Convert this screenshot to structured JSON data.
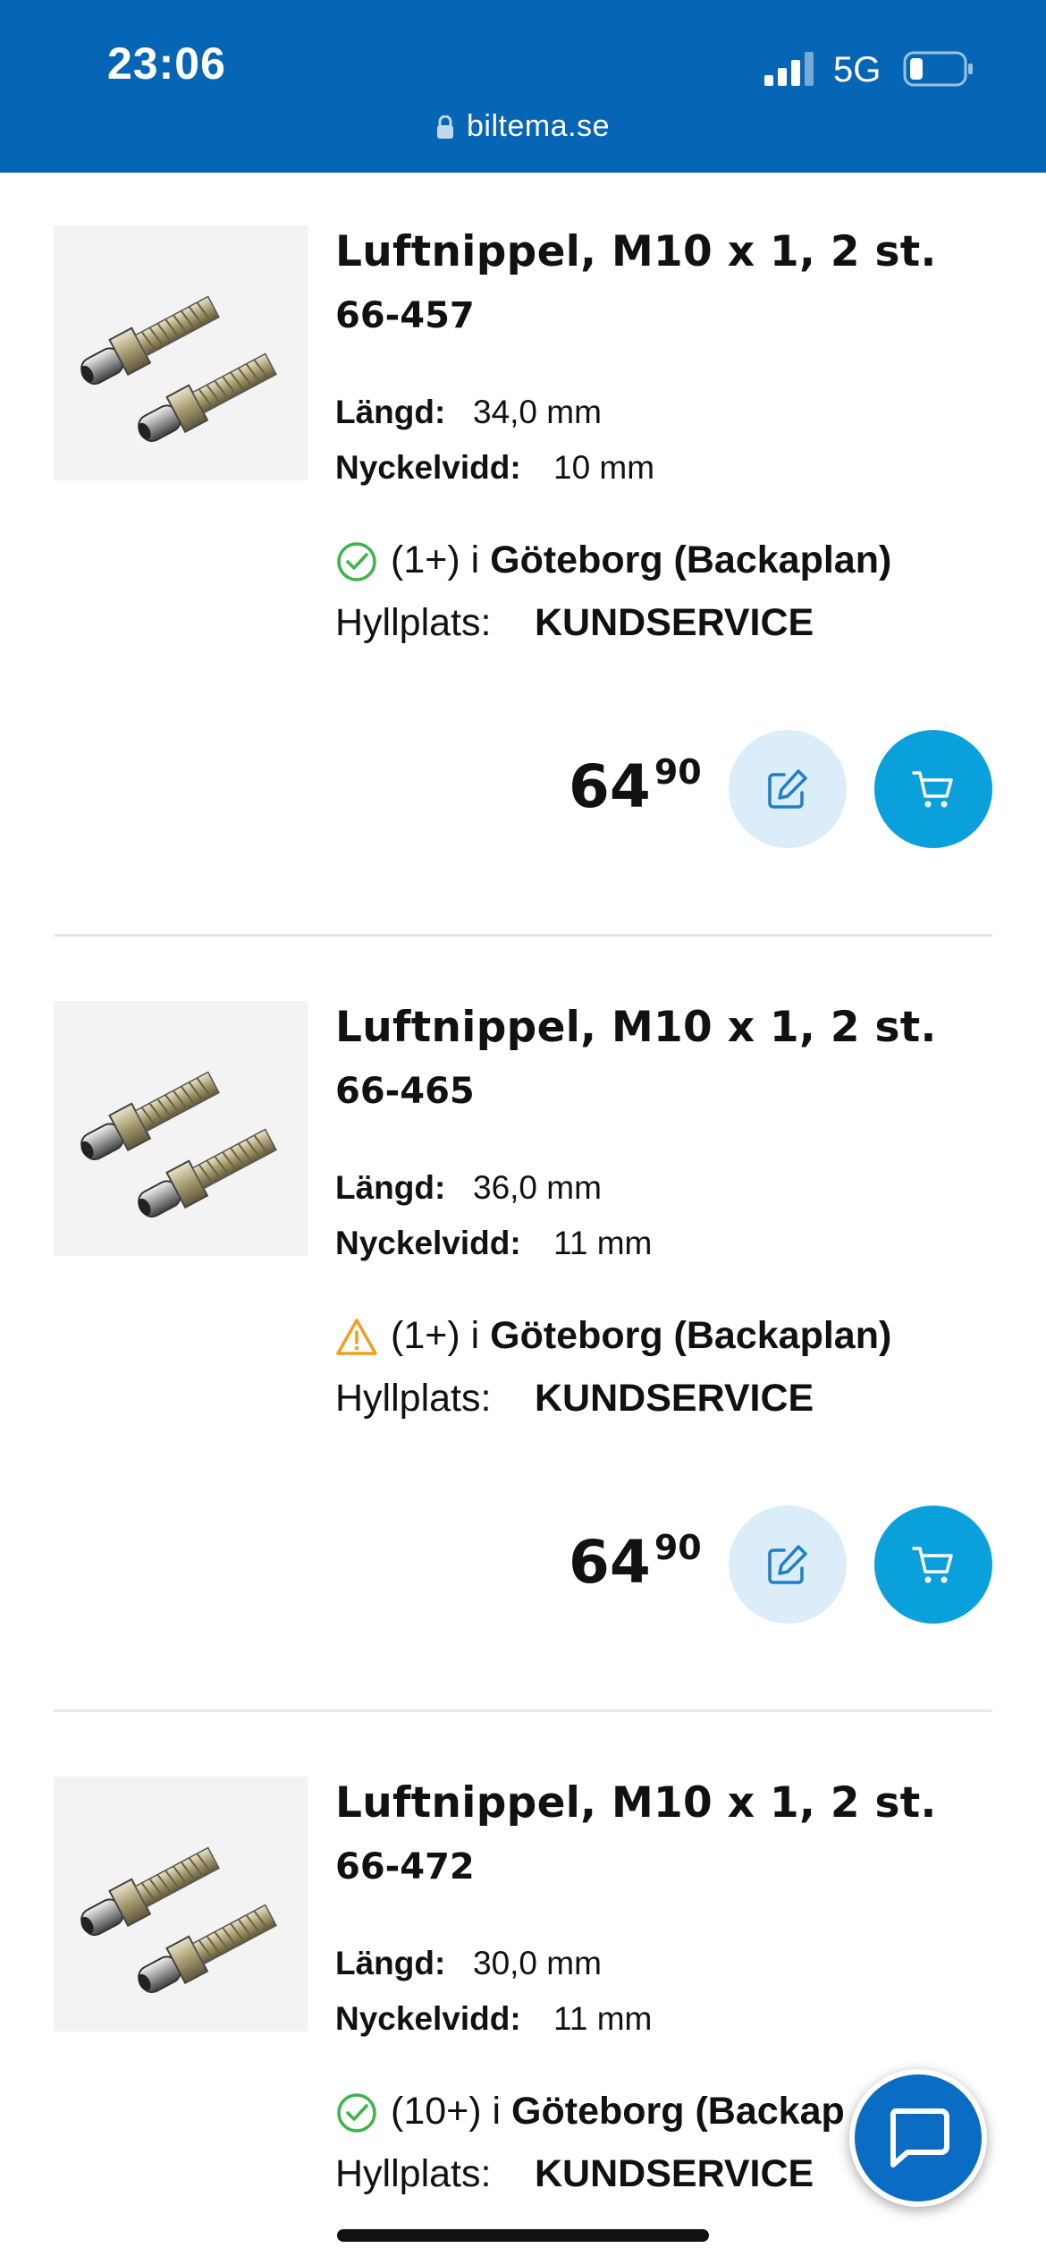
{
  "status_bar": {
    "time": "23:06",
    "network": "5G",
    "signal_icon": "signal-bars-icon",
    "battery_icon": "battery-low-icon"
  },
  "browser": {
    "url": "biltema.se",
    "lock_icon": "lock-icon"
  },
  "labels": {
    "length": "Längd:",
    "wrench_size": "Nyckelvidd:",
    "shelf": "Hyllplats:"
  },
  "colors": {
    "header": "#0765b5",
    "cart_button": "#0aa0dc",
    "edit_button": "#dbedf8",
    "in_stock": "#3cb44b",
    "warning": "#f0a020"
  },
  "products": [
    {
      "title": "Luftnippel, M10 x 1, 2 st.",
      "article_number": "66-457",
      "length": "34,0 mm",
      "wrench_size": "10 mm",
      "stock_status_icon": "check-circle-icon",
      "stock_count": "(1+) i",
      "store": "Göteborg (Backaplan)",
      "shelf_location": "KUNDSERVICE",
      "price_int": "64",
      "price_dec": "90"
    },
    {
      "title": "Luftnippel, M10 x 1, 2 st.",
      "article_number": "66-465",
      "length": "36,0 mm",
      "wrench_size": "11 mm",
      "stock_status_icon": "warning-triangle-icon",
      "stock_count": "(1+) i",
      "store": "Göteborg (Backaplan)",
      "shelf_location": "KUNDSERVICE",
      "price_int": "64",
      "price_dec": "90"
    },
    {
      "title": "Luftnippel, M10 x 1, 2 st.",
      "article_number": "66-472",
      "length": "30,0 mm",
      "wrench_size": "11 mm",
      "stock_status_icon": "check-circle-icon",
      "stock_count": "(10+) i",
      "store": "Göteborg (Backap",
      "shelf_location": "KUNDSERVICE"
    }
  ],
  "chat": {
    "icon": "chat-bubble-icon"
  }
}
